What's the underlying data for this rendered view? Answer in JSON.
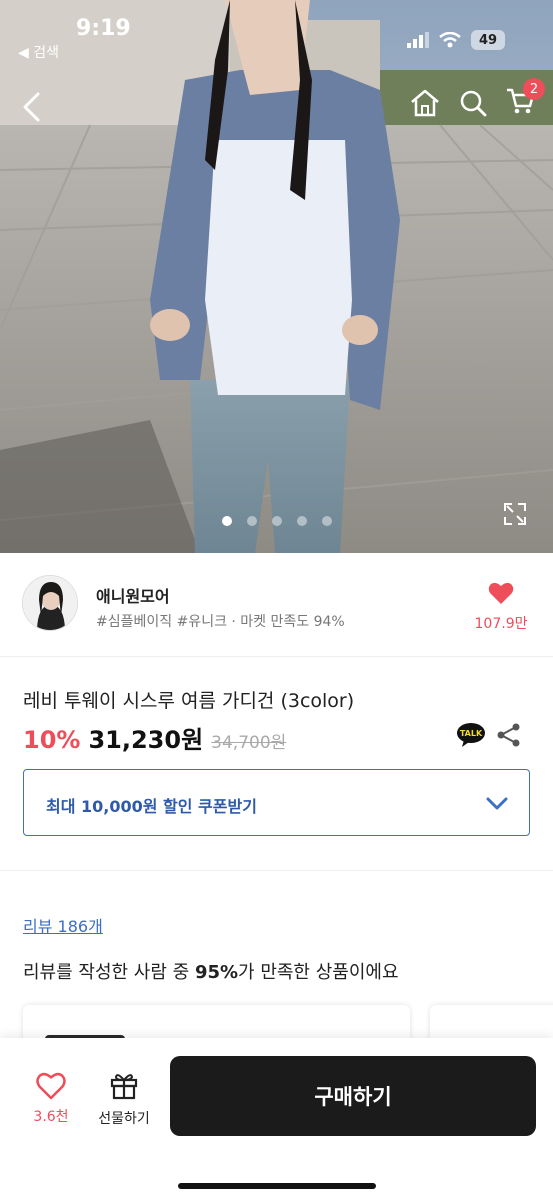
{
  "status_bar": {
    "time": "9:19",
    "back_app": "◀ 검색",
    "battery": "49"
  },
  "gallery": {
    "total_images": 5,
    "active_index": 0
  },
  "header": {
    "cart_count": "2"
  },
  "shop": {
    "name": "애니원모어",
    "tags": "#심플베이직 #유니크 · 마켓 만족도 94%",
    "like_count": "107.9만"
  },
  "product": {
    "title": "레비 투웨이 시스루 여름 가디건 (3color)",
    "discount": "10%",
    "price": "31,230원",
    "original_price": "34,700원",
    "talk_label": "TALK"
  },
  "coupon": {
    "label": "최대 10,000원 할인 쿠폰받기"
  },
  "reviews": {
    "link_label": "리뷰 186개",
    "summary_prefix": "리뷰를 작성한 사람 중 ",
    "summary_percent": "95%",
    "summary_suffix": "가 만족한 상품이에요"
  },
  "bottom_bar": {
    "wish_count": "3.6천",
    "gift_label": "선물하기",
    "buy_label": "구매하기"
  },
  "colors": {
    "accent_red": "#ee4d5a",
    "accent_blue": "#3c6fc6",
    "buy_button": "#1b1b1b"
  }
}
